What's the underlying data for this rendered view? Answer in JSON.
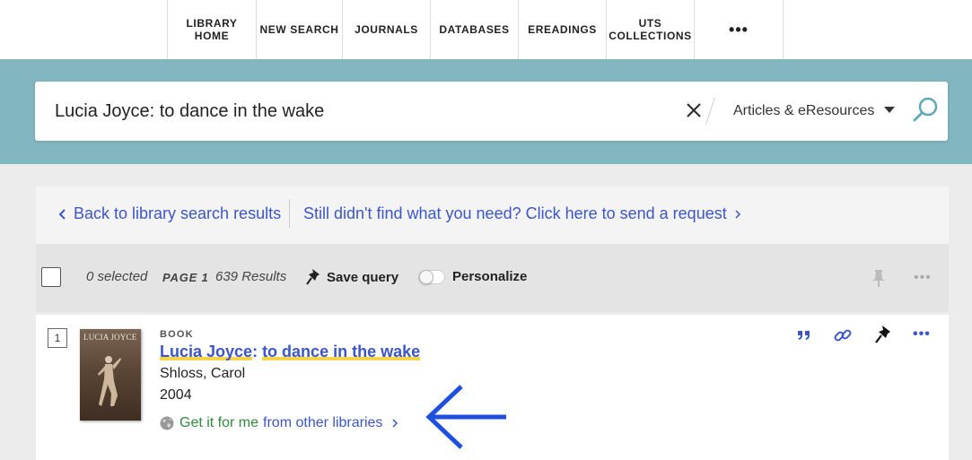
{
  "nav": {
    "items": [
      {
        "label": "LIBRARY\nHOME"
      },
      {
        "label": "NEW SEARCH"
      },
      {
        "label": "JOURNALS"
      },
      {
        "label": "DATABASES"
      },
      {
        "label": "EREADINGS"
      },
      {
        "label": "UTS\nCOLLECTIONS"
      },
      {
        "label": "•••"
      }
    ]
  },
  "search": {
    "query": "Lucia Joyce: to dance in the wake",
    "scope": "Articles & eResources",
    "icons": {
      "clear": "close-icon",
      "submit": "magnifier-icon",
      "caret": "caret-down-icon"
    }
  },
  "back_bar": {
    "back_label": "Back to library search results",
    "request_label": "Still didn't find what you need? Click here to send a request"
  },
  "results_bar": {
    "selected": "0 selected",
    "page": "PAGE 1",
    "count": "639 Results",
    "save_query": "Save query",
    "personalize": "Personalize"
  },
  "result": {
    "number": "1",
    "type": "BOOK",
    "title_part1": "Lucia Joyce",
    "title_colon": ": ",
    "title_part2": "to dance in the wake",
    "author": "Shloss, Carol",
    "year": "2004",
    "getit_green": "Get it for me",
    "getit_blue": "from other libraries",
    "thumb_title": "LUCIA JOYCE"
  },
  "colors": {
    "accent": "#3b56c6",
    "band": "#82b6c0",
    "highlight": "#f5d44a",
    "green": "#2f8a3c",
    "arrow": "#1f4fe0"
  }
}
